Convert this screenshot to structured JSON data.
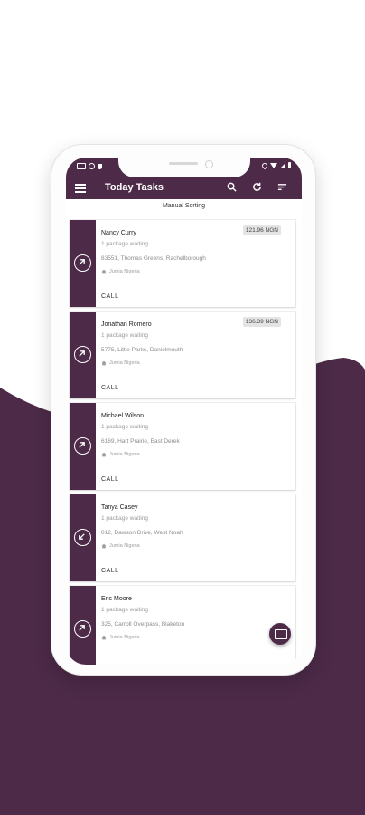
{
  "statusbar": {
    "left_icons": [
      "sim-icon",
      "alarm-icon",
      "shield-icon"
    ],
    "right_icons": [
      "location-icon",
      "wifi-icon",
      "signal-icon",
      "battery-icon"
    ]
  },
  "appbar": {
    "title": "Today Tasks",
    "icons": [
      "menu-icon",
      "search-icon",
      "refresh-icon",
      "sort-icon"
    ]
  },
  "subheader": "Manual Sorting",
  "tasks": [
    {
      "name": "Nancy Curry",
      "packages": "1 package waiting",
      "address": "83551, Thomas Greens, Rachelborough",
      "company": "Jumia Nigeria",
      "price": "121.96 NGN",
      "call": "CALL",
      "direction": "outgoing"
    },
    {
      "name": "Jonathan Romero",
      "packages": "1 package waiting",
      "address": "5775, Little Parks, Danielmouth",
      "company": "Jumia Nigeria",
      "price": "136.39 NGN",
      "call": "CALL",
      "direction": "outgoing"
    },
    {
      "name": "Michael Wilson",
      "packages": "1 package waiting",
      "address": "6169, Hart Prairie, East Derek",
      "company": "Jumia Nigeria",
      "price": "",
      "call": "CALL",
      "direction": "outgoing"
    },
    {
      "name": "Tanya Casey",
      "packages": "1 package waiting",
      "address": "012, Dawson Drive, West Noah",
      "company": "Jumia Nigeria",
      "price": "",
      "call": "CALL",
      "direction": "incoming"
    },
    {
      "name": "Eric Moore",
      "packages": "1 package waiting",
      "address": "325, Carroll Overpass, Blaketon",
      "company": "Jumia Nigeria",
      "price": "",
      "call": "",
      "direction": "outgoing"
    }
  ],
  "fab": {
    "icon": "keyboard-icon"
  },
  "colors": {
    "brand": "#4c2a48",
    "background": "#ffffff"
  }
}
